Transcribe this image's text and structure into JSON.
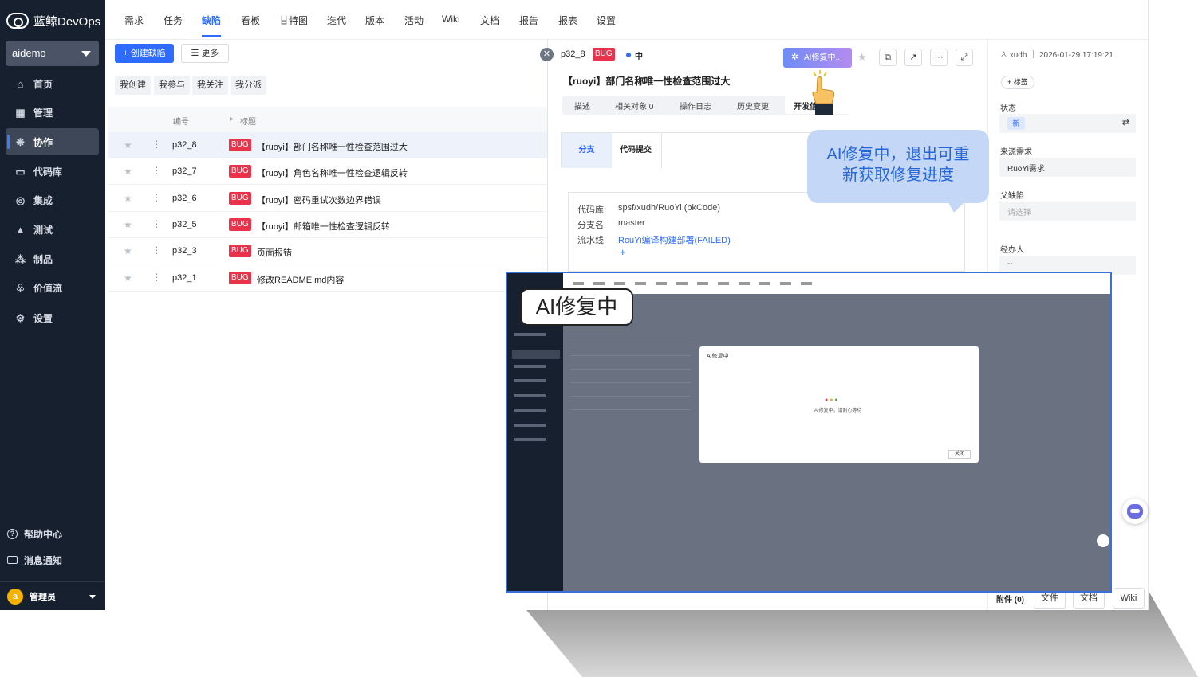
{
  "app": {
    "brand": "蓝鲸DevOps",
    "project": "aidemo"
  },
  "sidebar": {
    "items": [
      {
        "label": "首页",
        "icon": "home-icon"
      },
      {
        "label": "管理",
        "icon": "grid-icon"
      },
      {
        "label": "协作",
        "icon": "collab-icon",
        "active": true
      },
      {
        "label": "代码库",
        "icon": "repo-icon"
      },
      {
        "label": "集成",
        "icon": "integration-icon"
      },
      {
        "label": "测试",
        "icon": "test-icon"
      },
      {
        "label": "制品",
        "icon": "artifact-icon"
      },
      {
        "label": "价值流",
        "icon": "valuestream-icon"
      },
      {
        "label": "设置",
        "icon": "gear-icon"
      }
    ],
    "help": "帮助中心",
    "notify": "消息通知",
    "user": {
      "avatar": "a",
      "name": "管理员"
    }
  },
  "top_tabs": [
    "需求",
    "任务",
    "缺陷",
    "看板",
    "甘特图",
    "迭代",
    "版本",
    "活动",
    "Wiki",
    "文档",
    "报告",
    "报表",
    "设置"
  ],
  "active_tab": "缺陷",
  "toolbar": {
    "create": "+ 创建缺陷",
    "more": "☰ 更多"
  },
  "filters": [
    "我创建",
    "我参与",
    "我关注",
    "我分派"
  ],
  "table": {
    "headers": {
      "code": "编号",
      "title": "标题"
    },
    "rows": [
      {
        "code": "p32_8",
        "badge": "BUG",
        "title": "【ruoyi】部门名称唯一性检查范围过大"
      },
      {
        "code": "p32_7",
        "badge": "BUG",
        "title": "【ruoyi】角色名称唯一性检查逻辑反转"
      },
      {
        "code": "p32_6",
        "badge": "BUG",
        "title": "【ruoyi】密码重试次数边界错误"
      },
      {
        "code": "p32_5",
        "badge": "BUG",
        "title": "【ruoyi】邮箱唯一性检查逻辑反转"
      },
      {
        "code": "p32_3",
        "badge": "BUG",
        "title": "页面报错"
      },
      {
        "code": "p32_1",
        "badge": "BUG",
        "title": "修改README.md内容"
      }
    ]
  },
  "detail": {
    "id": "p32_8",
    "badge": "BUG",
    "priority": "中",
    "ai_button": "AI修复中...",
    "title": "【ruoyi】部门名称唯一性检查范围过大",
    "subtabs": [
      "描述",
      "相关对象 0",
      "操作日志",
      "历史变更",
      "开发信息"
    ],
    "dev_tabs": [
      "分支",
      "代码提交"
    ],
    "repo_label": "代码库:",
    "repo_value": "spsf/xudh/RuoYi (bkCode)",
    "branch_label": "分支名:",
    "branch_value": "master",
    "pipeline_label": "流水线:",
    "pipeline_value": "RouYi编译构建部署(FAILED)",
    "add": "+"
  },
  "attributes": {
    "meta": "xudh ｜ 2026-01-29 17:19:21",
    "tag_button": "+ 标签",
    "status_label": "状态",
    "status_value": "新",
    "source_label": "来源需求",
    "source_value": "RuoYi需求",
    "parent_label": "父缺陷",
    "parent_placeholder": "请选择",
    "assignee_label": "经办人",
    "assignee_value": "--"
  },
  "callout": {
    "line1": "AI修复中，退出可重",
    "line2": "新获取修复进度"
  },
  "inset": {
    "label": "AI修复中",
    "dialog_title": "AI修复中",
    "dialog_text": "AI修复中，请耐心等待",
    "dialog_button": "关闭"
  },
  "bottom": {
    "attachment": "附件 (0)",
    "file": "文件",
    "doc": "文档",
    "wiki": "Wiki"
  },
  "colors": {
    "accent": "#2f6bff",
    "bug": "#e8334a",
    "sidebar": "#16202f",
    "callout": "#c5d7f7"
  }
}
